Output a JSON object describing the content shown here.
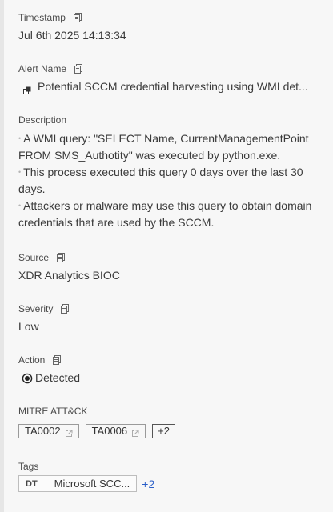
{
  "timestamp": {
    "label": "Timestamp",
    "value": "Jul 6th 2025 14:13:34"
  },
  "alert_name": {
    "label": "Alert Name",
    "value": "Potential SCCM credential harvesting using WMI det..."
  },
  "description": {
    "label": "Description",
    "lines": [
      {
        "bullet": "•",
        "text": "A WMI query: \"SELECT Name, CurrentManagementPoint"
      },
      {
        "bullet": "",
        "text": "FROM SMS_Authotity\" was executed by python.exe."
      },
      {
        "bullet": "•",
        "text": "This process executed this query 0 days over the last 30"
      },
      {
        "bullet": "",
        "text": "days."
      },
      {
        "bullet": "•",
        "text": "Attackers or malware may use this query to obtain domain"
      },
      {
        "bullet": "",
        "text": "credentials that are used by the SCCM."
      }
    ]
  },
  "source": {
    "label": "Source",
    "value": "XDR Analytics BIOC"
  },
  "severity": {
    "label": "Severity",
    "value": "Low"
  },
  "action": {
    "label": "Action",
    "value": "Detected"
  },
  "mitre": {
    "label": "MITRE ATT&CK",
    "tactics": [
      "TA0002",
      "TA0006"
    ],
    "more": "+2"
  },
  "tags": {
    "label": "Tags",
    "prefix": "DT",
    "value": "Microsoft SCC...",
    "more": "+2"
  },
  "colors": {
    "link": "#2a5ec8",
    "text": "#3a3a3a",
    "border": "#9a9a9a"
  }
}
